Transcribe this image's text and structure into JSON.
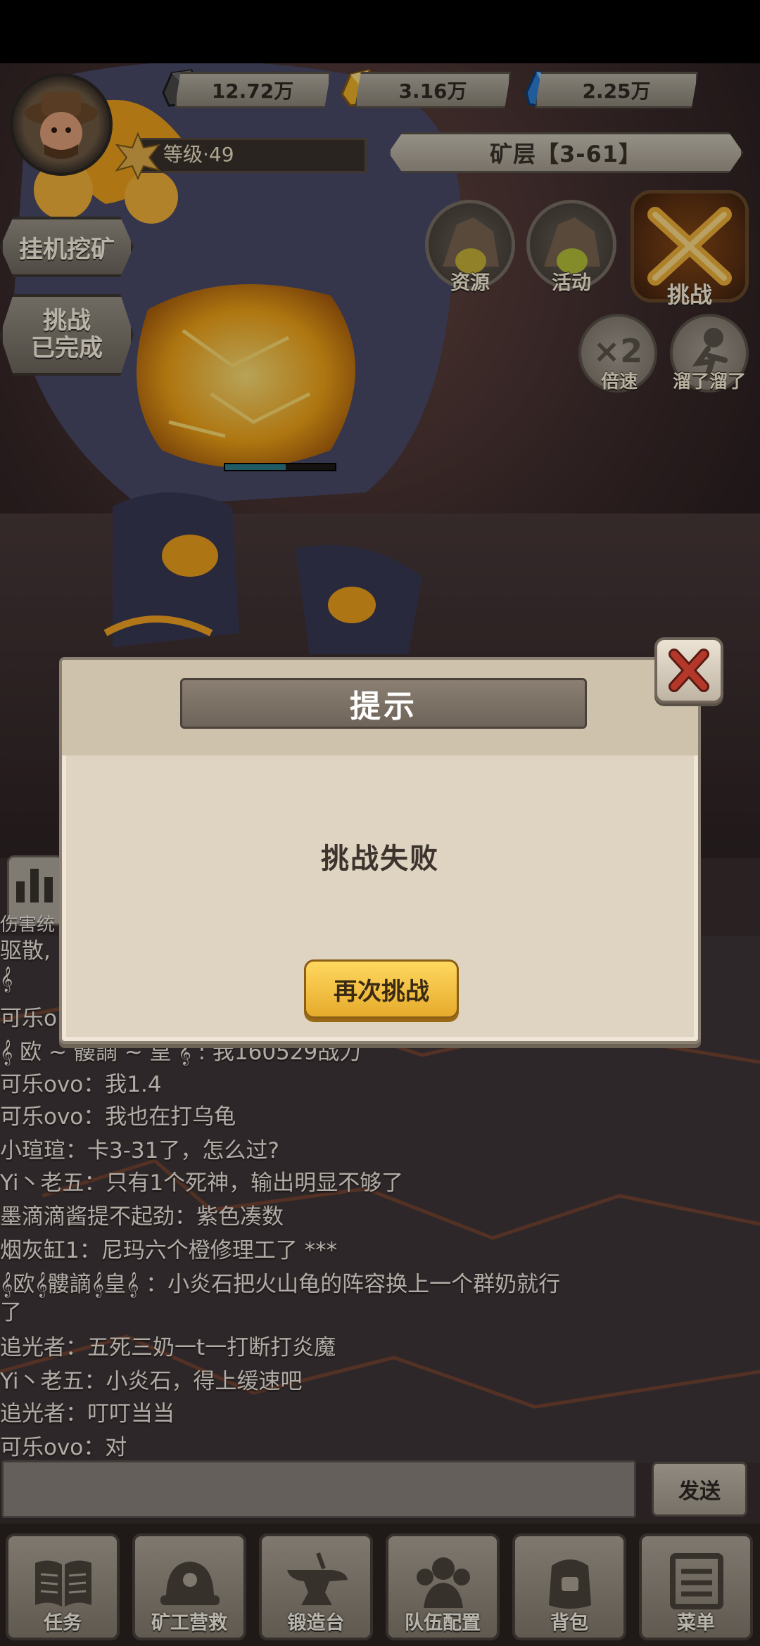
{
  "hud": {
    "resources": [
      {
        "name": "stone",
        "value": "12.72万"
      },
      {
        "name": "gold",
        "value": "3.16万"
      },
      {
        "name": "gem",
        "value": "2.25万"
      }
    ],
    "level_text": "等级·49",
    "mine_layer": "矿层【3-61】"
  },
  "side_buttons": {
    "idle_mining": "挂机挖矿",
    "challenge_line1": "挑战",
    "challenge_line2": "已完成"
  },
  "round_buttons": {
    "resources": "资源",
    "activity": "活动",
    "challenge": "挑战",
    "speed_symbol": "×2",
    "speed": "倍速",
    "escape": "溜了溜了"
  },
  "chat": {
    "damage_tab": "伤害统",
    "lines": [
      "驱散,",
      "𝄞",
      "可乐o",
      "𝄞 欧 ~ 髏謫 ~ 皇 𝄞 : 我160529战力",
      "可乐ovo：我1.4",
      "可乐ovo：我也在打乌龟",
      "小瑄瑄：卡3-31了，怎么过?",
      "Yi丶老五：只有1个死神，输出明显不够了",
      "墨滴滴酱提不起劲：紫色凑数",
      "烟灰缸1：尼玛六个橙修理工了 ***",
      "𝄞欧𝄞髏謫𝄞皇𝄞 ：小炎石把火山龟的阵容换上一个群奶就行",
      "了",
      "追光者：五死三奶一t一打断打炎魔",
      "Yi丶老五：小炎石，得上缓速吧",
      "追光者：叮叮当当",
      "可乐ovo：对"
    ],
    "send": "发送"
  },
  "menu": [
    {
      "label": "任务",
      "icon": "book-icon"
    },
    {
      "label": "矿工营救",
      "icon": "helmet-icon"
    },
    {
      "label": "锻造台",
      "icon": "anvil-icon"
    },
    {
      "label": "队伍配置",
      "icon": "team-icon"
    },
    {
      "label": "背包",
      "icon": "backpack-icon"
    },
    {
      "label": "菜单",
      "icon": "menu-icon"
    }
  ],
  "modal": {
    "title": "提示",
    "message": "挑战失败",
    "retry": "再次挑战"
  },
  "colors": {
    "lava": "#f5a623",
    "retry_button": "#f2c443",
    "close_x": "#b4382a"
  }
}
